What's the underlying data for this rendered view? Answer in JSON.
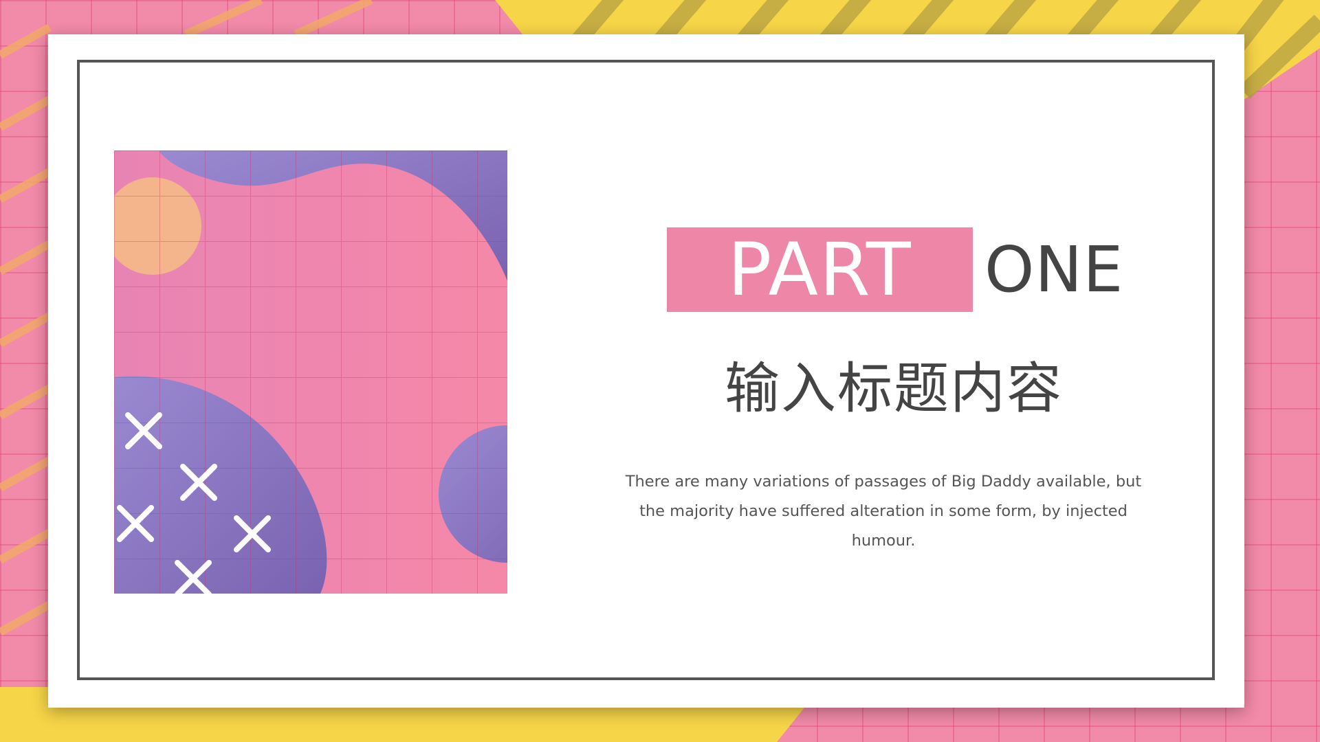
{
  "slide": {
    "heading_highlight": "PART",
    "heading_rest": "ONE",
    "title": "输入标题内容",
    "body": "There are many variations of passages of Big Daddy available, but the majority have suffered alteration in some form, by injected humour."
  },
  "colors": {
    "background_pink": "#f28aa9",
    "stripe_yellow": "#f7d548",
    "card_white": "#ffffff",
    "frame_gray": "#555555",
    "heading_box_pink": "#ee86a8",
    "purple": "#8b78c4",
    "peach": "#f4b48c",
    "text_dark": "#444444"
  },
  "icons": {
    "illustration": "abstract-blob-illustration",
    "crosses": "x-mark-icon"
  }
}
